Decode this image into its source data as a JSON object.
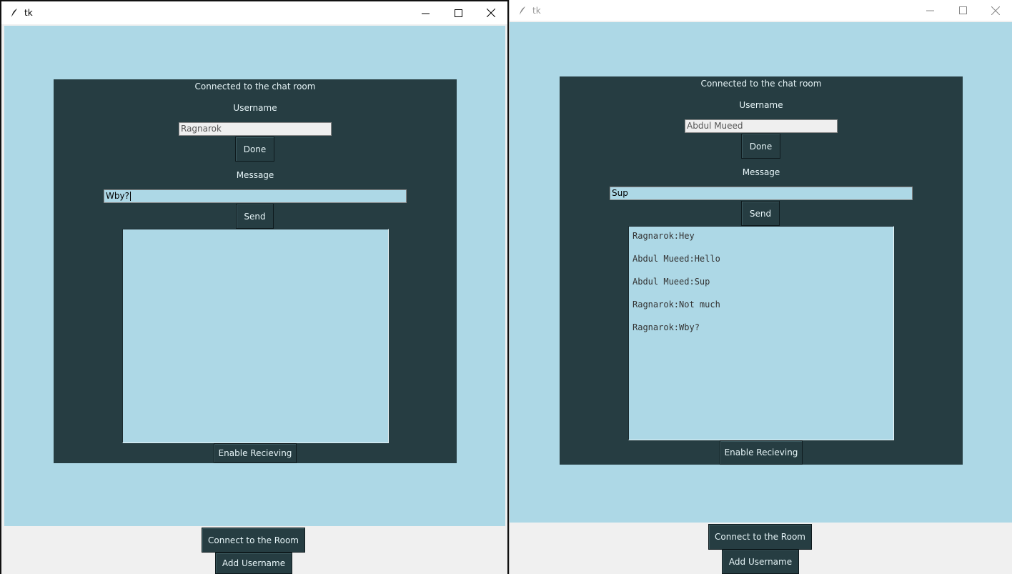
{
  "windows": {
    "left": {
      "title": "tk",
      "status_label": "Connected to the chat room",
      "username_label": "Username",
      "username_value": "Ragnarok",
      "done_label": "Done",
      "message_label": "Message",
      "message_value": "Wby?",
      "send_label": "Send",
      "enable_label": "Enable Recieving",
      "connect_label": "Connect to the Room",
      "add_username_label": "Add Username"
    },
    "right": {
      "title": "tk",
      "status_label": "Connected to the chat room",
      "username_label": "Username",
      "username_value": "Abdul Mueed",
      "done_label": "Done",
      "message_label": "Message",
      "message_value": "Sup",
      "send_label": "Send",
      "messages": [
        "Ragnarok:Hey",
        "Abdul Mueed:Hello",
        "Abdul Mueed:Sup",
        "Ragnarok:Not much",
        "Ragnarok:Wby?"
      ],
      "enable_label": "Enable Recieving",
      "connect_label": "Connect to the Room",
      "add_username_label": "Add Username"
    }
  },
  "titlebar_icons": [
    "minimize-icon",
    "maximize-icon",
    "close-icon"
  ],
  "colors": {
    "canvas": "#add8e6",
    "panel": "#263d42",
    "window_bg": "#f0f0f0"
  }
}
